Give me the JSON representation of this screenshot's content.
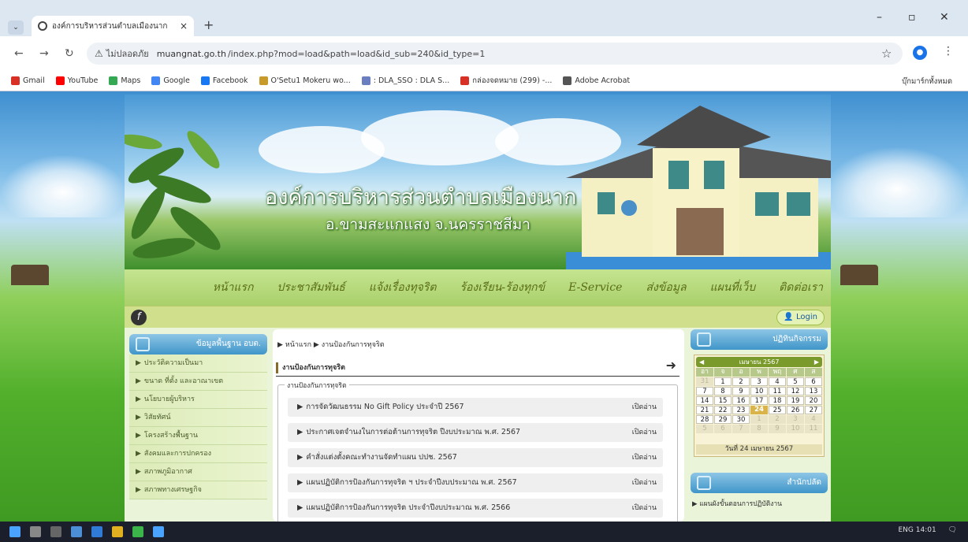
{
  "browser": {
    "tab_title": "องค์การบริหารส่วนตำบลเมืองนาก",
    "tab_close": "×",
    "new_tab": "+",
    "tab_menu": "⌄",
    "win_min": "–",
    "win_max": "▫",
    "win_close": "✕",
    "back": "←",
    "forward": "→",
    "reload": "↻",
    "not_secure": "ไม่ปลอดภัย",
    "url_host": "muangnat.go.th",
    "url_path": "/index.php?mod=load&path=load&id_sub=240&id_type=1",
    "star": "☆",
    "profile": "●",
    "menu": "⋮",
    "bookmarks": [
      {
        "label": "Gmail",
        "color": "#d93025"
      },
      {
        "label": "YouTube",
        "color": "#ff0000"
      },
      {
        "label": "Maps",
        "color": "#34a853"
      },
      {
        "label": "Google",
        "color": "#4285f4"
      },
      {
        "label": "Facebook",
        "color": "#1877f2"
      },
      {
        "label": "O'Setu1 Mokeru wo...",
        "color": "#c89a2a"
      },
      {
        "label": ": DLA_SSO : DLA S...",
        "color": "#6b7fc0"
      },
      {
        "label": "กล่องจดหมาย (299) -...",
        "color": "#d93025"
      },
      {
        "label": "Adobe Acrobat",
        "color": "#555555"
      }
    ],
    "all_bookmarks": "บุ๊กมาร์กทั้งหมด"
  },
  "site": {
    "title": "องค์การบริหารส่วนตำบลเมืองนาก",
    "subtitle": "อ.ขามสะแกแสง จ.นครราชสีมา",
    "menu": [
      "หน้าแรก",
      "ประชาสัมพันธ์",
      "แจ้งเรื่องทุจริต",
      "ร้องเรียน-ร้องทุกข์",
      "E-Service",
      "ส่งข้อมูล",
      "แผนที่เว็บ",
      "ติดต่อเรา"
    ],
    "flash_icon": "f",
    "login_icon": "👤",
    "login": "Login",
    "left_box_title": "ข้อมูลพื้นฐาน อบต.",
    "left_items": [
      "ประวัติความเป็นมา",
      "ขนาด ที่ตั้ง และอาณาเขต",
      "นโยบายผู้บริหาร",
      "วิสัยทัศน์",
      "โครงสร้างพื้นฐาน",
      "สังคมและการปกครอง",
      "สภาพภูมิอากาศ",
      "สภาพทางเศรษฐกิจ"
    ],
    "breadcrumb_home": "หน้าแรก",
    "breadcrumb_sep": "▶",
    "breadcrumb_current": "งานป้องกันการทุจริต",
    "section_title": "งานป้องกันการทุจริต",
    "section_arrow": "➜",
    "fieldset_legend": "งานป้องกันการทุจริต",
    "rows": [
      "การจัดวัฒนธรรม No Gift Policy ประจำปี 2567",
      "ประกาศเจตจำนงในการต่อต้านการทุจริต ปีงบประมาณ พ.ศ. 2567",
      "คำสั่งแต่งตั้งคณะทำงานจัดทำแผน ปปช. 2567",
      "แผนปฏิบัติการป้องกันการทุจริต ฯ ประจำปีงบประมาณ พ.ศ. 2567",
      "แผนปฏิบัติการป้องกันการทุจริต ประจำปีงบประมาณ พ.ศ. 2566"
    ],
    "read_label": "เปิดอ่าน",
    "row_marker": "▶",
    "calendar_title": "ปฏิทินกิจกรรม",
    "calendar_month": "เมษายน 2567",
    "calendar_prev": "◀",
    "calendar_next": "▶",
    "calendar_days": [
      "อา",
      "จ",
      "อ",
      "พ",
      "พฤ",
      "ศ",
      "ส"
    ],
    "calendar_cells": [
      {
        "d": "31",
        "c": "o"
      },
      {
        "d": "1",
        "c": "d"
      },
      {
        "d": "2",
        "c": "d"
      },
      {
        "d": "3",
        "c": "d"
      },
      {
        "d": "4",
        "c": "d"
      },
      {
        "d": "5",
        "c": "d"
      },
      {
        "d": "6",
        "c": "d"
      },
      {
        "d": "7",
        "c": "d"
      },
      {
        "d": "8",
        "c": "d"
      },
      {
        "d": "9",
        "c": "d"
      },
      {
        "d": "10",
        "c": "d"
      },
      {
        "d": "11",
        "c": "d"
      },
      {
        "d": "12",
        "c": "d"
      },
      {
        "d": "13",
        "c": "d"
      },
      {
        "d": "14",
        "c": "d"
      },
      {
        "d": "15",
        "c": "d"
      },
      {
        "d": "16",
        "c": "d"
      },
      {
        "d": "17",
        "c": "d"
      },
      {
        "d": "18",
        "c": "d"
      },
      {
        "d": "19",
        "c": "d"
      },
      {
        "d": "20",
        "c": "d"
      },
      {
        "d": "21",
        "c": "d"
      },
      {
        "d": "22",
        "c": "d"
      },
      {
        "d": "23",
        "c": "d"
      },
      {
        "d": "24",
        "c": "td"
      },
      {
        "d": "25",
        "c": "d"
      },
      {
        "d": "26",
        "c": "d"
      },
      {
        "d": "27",
        "c": "d"
      },
      {
        "d": "28",
        "c": "d"
      },
      {
        "d": "29",
        "c": "d"
      },
      {
        "d": "30",
        "c": "d"
      },
      {
        "d": "1",
        "c": "o"
      },
      {
        "d": "2",
        "c": "o"
      },
      {
        "d": "3",
        "c": "o"
      },
      {
        "d": "4",
        "c": "o"
      },
      {
        "d": "5",
        "c": "o"
      },
      {
        "d": "6",
        "c": "o"
      },
      {
        "d": "7",
        "c": "o"
      },
      {
        "d": "8",
        "c": "o"
      },
      {
        "d": "9",
        "c": "o"
      },
      {
        "d": "10",
        "c": "o"
      },
      {
        "d": "11",
        "c": "o"
      }
    ],
    "calendar_today": "วันที่ 24 เมษายน 2567",
    "office_title": "สำนักปลัด",
    "office_link": "แผนผังขั้นตอนการปฏิบัติงาน"
  },
  "taskbar": {
    "tray": "ENG  14:01",
    "notify": "🗨"
  }
}
